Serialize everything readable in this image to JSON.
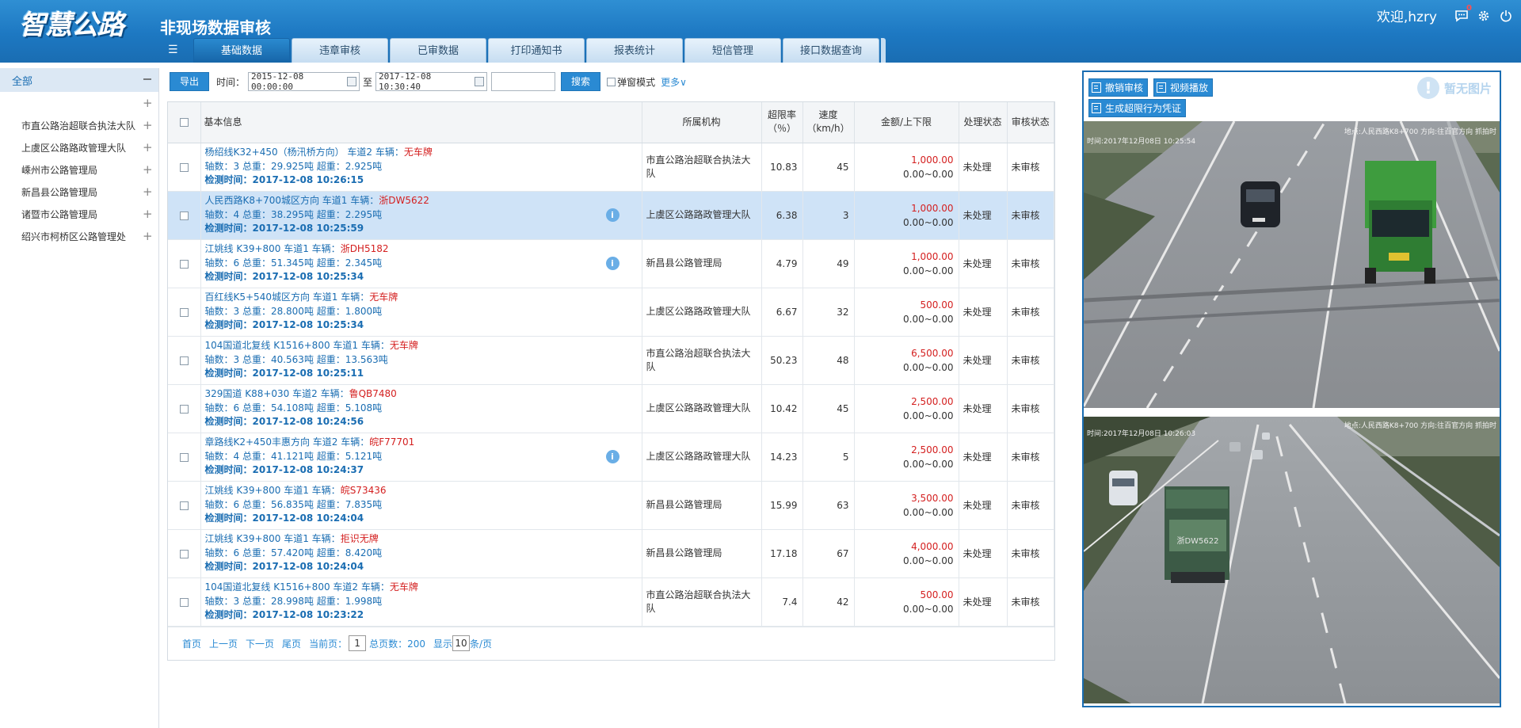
{
  "header": {
    "logo": "智慧公路",
    "subtitle": "非现场数据审核",
    "welcome": "欢迎,hzry",
    "message_count": "0",
    "icons": [
      "chat-icon",
      "gear-icon",
      "power-icon"
    ]
  },
  "nav": {
    "tabs": [
      {
        "label": "基础数据",
        "active": true
      },
      {
        "label": "违章审核",
        "active": false
      },
      {
        "label": "已审数据",
        "active": false
      },
      {
        "label": "打印通知书",
        "active": false
      },
      {
        "label": "报表统计",
        "active": false
      },
      {
        "label": "短信管理",
        "active": false
      },
      {
        "label": "接口数据查询",
        "active": false
      }
    ]
  },
  "sidebar": {
    "root": "全部",
    "items": [
      "市直公路治超联合执法大队",
      "上虞区公路路政管理大队",
      "嵊州市公路管理局",
      "新昌县公路管理局",
      "诸暨市公路管理局",
      "绍兴市柯桥区公路管理处"
    ]
  },
  "toolbar": {
    "export_label": "导出",
    "time_label": "时间：",
    "start_time": "2015-12-08 00:00:00",
    "to_label": "至",
    "end_time": "2017-12-08 10:30:40",
    "search_value": "",
    "search_label": "搜索",
    "popup_mode_label": "弹窗模式",
    "more_label": "更多∨"
  },
  "table": {
    "headers": {
      "basic": "基本信息",
      "org": "所属机构",
      "over_rate": "超限率",
      "over_rate_unit": "（％）",
      "speed": "速度",
      "speed_unit": "（km/h）",
      "amount": "金额/上下限",
      "process": "处理状态",
      "review": "审核状态"
    },
    "rows": [
      {
        "loc": "杨绍线K32+450（杨汛桥方向） 车道2 车辆：",
        "plate": "无车牌",
        "weight": "轴数：3 总重：29.925吨 超重：2.925吨",
        "time": "检测时间：2017-12-08 10:26:15",
        "info": false,
        "org": "市直公路治超联合执法大队",
        "rate": "10.83",
        "speed": "45",
        "fine": "1,000.00",
        "range": "0.00~0.00",
        "process": "未处理",
        "review": "未审核"
      },
      {
        "loc": "人民西路K8+700城区方向 车道1 车辆：",
        "plate": "浙DW5622",
        "weight": "轴数：4 总重：38.295吨 超重：2.295吨",
        "time": "检测时间：2017-12-08 10:25:59",
        "info": true,
        "org": "上虞区公路路政管理大队",
        "rate": "6.38",
        "speed": "3",
        "fine": "1,000.00",
        "range": "0.00~0.00",
        "process": "未处理",
        "review": "未审核",
        "selected": true
      },
      {
        "loc": "江姚线 K39+800 车道1 车辆：",
        "plate": "浙DH5182",
        "weight": "轴数：6 总重：51.345吨 超重：2.345吨",
        "time": "检测时间：2017-12-08 10:25:34",
        "info": true,
        "org": "新昌县公路管理局",
        "rate": "4.79",
        "speed": "49",
        "fine": "1,000.00",
        "range": "0.00~0.00",
        "process": "未处理",
        "review": "未审核"
      },
      {
        "loc": "百红线K5+540城区方向 车道1 车辆：",
        "plate": "无车牌",
        "weight": "轴数：3 总重：28.800吨 超重：1.800吨",
        "time": "检测时间：2017-12-08 10:25:34",
        "info": false,
        "org": "上虞区公路路政管理大队",
        "rate": "6.67",
        "speed": "32",
        "fine": "500.00",
        "range": "0.00~0.00",
        "process": "未处理",
        "review": "未审核"
      },
      {
        "loc": "104国道北复线 K1516+800 车道1 车辆：",
        "plate": "无车牌",
        "weight": "轴数：3 总重：40.563吨 超重：13.563吨",
        "time": "检测时间：2017-12-08 10:25:11",
        "info": false,
        "org": "市直公路治超联合执法大队",
        "rate": "50.23",
        "speed": "48",
        "fine": "6,500.00",
        "range": "0.00~0.00",
        "process": "未处理",
        "review": "未审核"
      },
      {
        "loc": "329国道 K88+030 车道2 车辆：",
        "plate": "鲁QB7480",
        "weight": "轴数：6 总重：54.108吨 超重：5.108吨",
        "time": "检测时间：2017-12-08 10:24:56",
        "info": false,
        "org": "上虞区公路路政管理大队",
        "rate": "10.42",
        "speed": "45",
        "fine": "2,500.00",
        "range": "0.00~0.00",
        "process": "未处理",
        "review": "未审核"
      },
      {
        "loc": "章路线K2+450丰惠方向 车道2 车辆：",
        "plate": "皖F77701",
        "weight": "轴数：4 总重：41.121吨 超重：5.121吨",
        "time": "检测时间：2017-12-08 10:24:37",
        "info": true,
        "org": "上虞区公路路政管理大队",
        "rate": "14.23",
        "speed": "5",
        "fine": "2,500.00",
        "range": "0.00~0.00",
        "process": "未处理",
        "review": "未审核"
      },
      {
        "loc": "江姚线 K39+800 车道1 车辆：",
        "plate": "皖S73436",
        "weight": "轴数：6 总重：56.835吨 超重：7.835吨",
        "time": "检测时间：2017-12-08 10:24:04",
        "info": false,
        "org": "新昌县公路管理局",
        "rate": "15.99",
        "speed": "63",
        "fine": "3,500.00",
        "range": "0.00~0.00",
        "process": "未处理",
        "review": "未审核"
      },
      {
        "loc": "江姚线 K39+800 车道1 车辆：",
        "plate": "拒识无牌",
        "weight": "轴数：6 总重：57.420吨 超重：8.420吨",
        "time": "检测时间：2017-12-08 10:24:04",
        "info": false,
        "org": "新昌县公路管理局",
        "rate": "17.18",
        "speed": "67",
        "fine": "4,000.00",
        "range": "0.00~0.00",
        "process": "未处理",
        "review": "未审核"
      },
      {
        "loc": "104国道北复线 K1516+800 车道2 车辆：",
        "plate": "无车牌",
        "weight": "轴数：3 总重：28.998吨 超重：1.998吨",
        "time": "检测时间：2017-12-08 10:23:22",
        "info": false,
        "org": "市直公路治超联合执法大队",
        "rate": "7.4",
        "speed": "42",
        "fine": "500.00",
        "range": "0.00~0.00",
        "process": "未处理",
        "review": "未审核"
      }
    ]
  },
  "pager": {
    "first": "首页",
    "prev": "上一页",
    "next": "下一页",
    "last": "尾页",
    "current_label": "当前页：",
    "current": "1",
    "total_label": "总页数：200",
    "show_label": "显示",
    "page_size": "10",
    "per_page_label": "条/页"
  },
  "panel": {
    "cancel_review": "撤销审核",
    "video_play": "视频播放",
    "gen_evidence": "生成超限行为凭证",
    "no_image": "暂无图片",
    "photo1": {
      "overlay_left": "时间:2017年12月08日 10:25:54",
      "overlay_right": "地点:人民西路K8+700 方向:往百官方向 抓拍时"
    },
    "photo2": {
      "overlay_left": "时间:2017年12月08日 10:26:03",
      "overlay_right": "地点:人民西路K8+700 方向:往百官方向 抓拍时",
      "truck_plate": "浙DW5622"
    }
  }
}
